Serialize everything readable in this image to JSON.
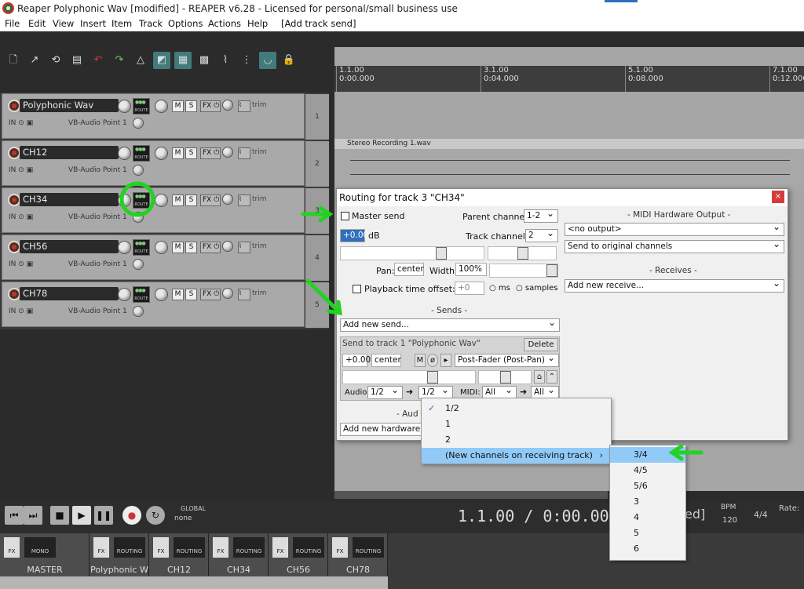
{
  "window": {
    "title": "Reaper Polyphonic Wav [modified] - REAPER v6.28 - Licensed for personal/small business use"
  },
  "menu": [
    "File",
    "Edit",
    "View",
    "Insert",
    "Item",
    "Track",
    "Options",
    "Actions",
    "Help",
    "[Add track send]"
  ],
  "tracks": [
    {
      "name": "Polyphonic Wav",
      "input": "VB-Audio Point 1",
      "number": "1"
    },
    {
      "name": "CH12",
      "input": "VB-Audio Point 1",
      "number": "2"
    },
    {
      "name": "CH34",
      "input": "VB-Audio Point 1",
      "number": "3"
    },
    {
      "name": "CH56",
      "input": "VB-Audio Point 1",
      "number": "4"
    },
    {
      "name": "CH78",
      "input": "VB-Audio Point 1",
      "number": "5"
    }
  ],
  "track_labels": {
    "route": "ROUTE",
    "mute": "M",
    "solo": "S",
    "fx": "FX",
    "trim": "trim",
    "in": "IN"
  },
  "ruler": [
    {
      "bar": "1.1.00",
      "time": "0:00.000"
    },
    {
      "bar": "3.1.00",
      "time": "0:04.000"
    },
    {
      "bar": "5.1.00",
      "time": "0:08.000"
    },
    {
      "bar": "7.1.00",
      "time": "0:12.000"
    }
  ],
  "clip": {
    "name": "Stereo Recording 1.wav"
  },
  "transport": {
    "time": "1.1.00 / 0:00.000",
    "global": "GLOBAL",
    "global_value": "none",
    "bpm_label": "BPM",
    "bpm": "120",
    "sig": "4/4",
    "rate": "Rate:",
    "partial": "ed]"
  },
  "mixer": [
    {
      "name": "MASTER",
      "left": "FX",
      "right": "MONO"
    },
    {
      "name": "Polyphonic W",
      "left": "FX",
      "right": "ROUTING"
    },
    {
      "name": "CH12",
      "left": "FX",
      "right": "ROUTING"
    },
    {
      "name": "CH34",
      "left": "FX",
      "right": "ROUTING"
    },
    {
      "name": "CH56",
      "left": "FX",
      "right": "ROUTING"
    },
    {
      "name": "CH78",
      "left": "FX",
      "right": "ROUTING"
    }
  ],
  "dialog": {
    "title": "Routing for track 3 \"CH34\"",
    "master_send": "Master send",
    "parent_channels_label": "Parent channels:",
    "parent_channels": "1-2",
    "volume": "+0.00",
    "db": "dB",
    "track_channels_label": "Track channels:",
    "track_channels": "2",
    "pan_label": "Pan:",
    "pan": "center",
    "width_label": "Width:",
    "width": "100%",
    "playback_offset_label": "Playback time offset:",
    "playback_offset": "+0",
    "ms": "ms",
    "samples": "samples",
    "sends_header": "- Sends -",
    "add_send": "Add new send...",
    "send_to": "Send to track 1 \"Polyphonic Wav\"",
    "delete": "Delete",
    "send_vol": "+0.00",
    "send_pan": "center",
    "send_m": "M",
    "send_mode": "Post-Fader (Post-Pan)",
    "audio_label": "Audio:",
    "audio_src": "1/2",
    "audio_dst": "1/2",
    "midi_label": "MIDI:",
    "midi_src": "All",
    "midi_dst": "All",
    "aud_partial": "- Aud",
    "add_hw_output": "Add new hardware outp",
    "midi_hw_header": "- MIDI Hardware Output -",
    "midi_hw_output": "<no output>",
    "midi_hw_mode": "Send to original channels",
    "receives_header": "- Receives -",
    "add_receive": "Add new receive...",
    "close": "×"
  },
  "popup": {
    "items": [
      {
        "label": "1/2",
        "checked": true
      },
      {
        "label": "1"
      },
      {
        "label": "2"
      },
      {
        "label": "(New channels on receiving track)",
        "submenu": true
      }
    ],
    "check": "✓",
    "arrow": "›"
  },
  "submenu": {
    "items": [
      "3/4",
      "4/5",
      "5/6",
      "3",
      "4",
      "5",
      "6"
    ]
  },
  "colors": {
    "highlight": "#91c9f7",
    "annotation": "#22d322",
    "route_active": "#417b7b"
  }
}
